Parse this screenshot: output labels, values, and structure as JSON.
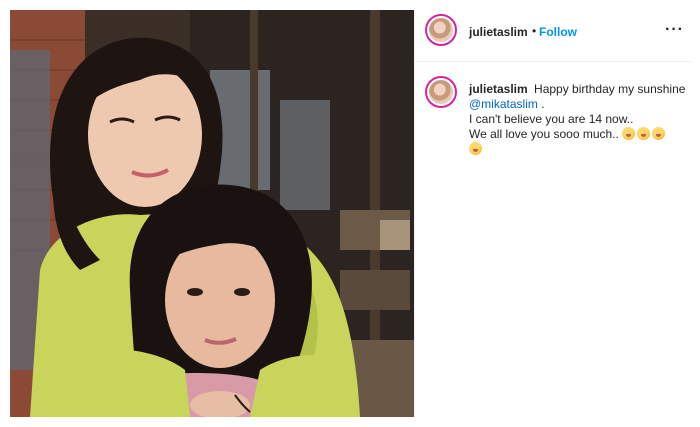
{
  "post": {
    "author": {
      "username": "julietaslim",
      "separator": "•",
      "follow_label": "Follow",
      "more_icon": "more-icon",
      "more_glyph": "···"
    },
    "caption": {
      "username": "julietaslim",
      "line1": "Happy birthday my sunshine",
      "mention": "@mikataslim",
      "line1_end": " .",
      "line2": "I can't believe you are 14 now..",
      "line3": "We all love you sooo much..",
      "emoji_name": "face-with-tongue-emoji",
      "emoji_count": 4
    },
    "colors": {
      "follow": "#0095f6",
      "mention": "#0064c8",
      "story_ring": "#d6249f"
    }
  }
}
